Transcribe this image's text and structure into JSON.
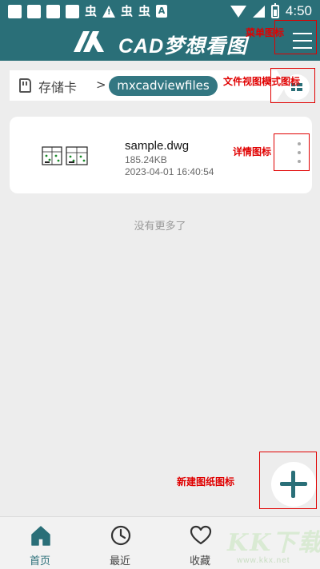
{
  "colors": {
    "primary": "#2a6f78",
    "annotation": "#e00000",
    "background": "#ededed"
  },
  "status_bar": {
    "time": "4:50",
    "glyph": "虫",
    "alert": "A",
    "battery_level": 0.6
  },
  "header": {
    "app_title": "CAD梦想看图",
    "logo_icon": "cad-logo-icon",
    "menu_icon": "hamburger-menu-icon"
  },
  "breadcrumb": {
    "storage_label": "存储卡",
    "separator": ">",
    "current_folder": "mxcadviewfiles"
  },
  "files": [
    {
      "name": "sample.dwg",
      "size": "185.24KB",
      "date": "2023-04-01 16:40:54"
    }
  ],
  "list_footer": "没有更多了",
  "annotations": {
    "menu": "菜单图标",
    "view_mode": "文件视图模式图标",
    "detail": "详情图标",
    "new_drawing": "新建图纸图标"
  },
  "bottom_nav": [
    {
      "label": "首页",
      "icon": "home-icon",
      "active": true
    },
    {
      "label": "最近",
      "icon": "clock-icon",
      "active": false
    },
    {
      "label": "收藏",
      "icon": "heart-icon",
      "active": false
    }
  ],
  "watermark": {
    "main": "KK下载",
    "sub": "www.kkx.net"
  }
}
